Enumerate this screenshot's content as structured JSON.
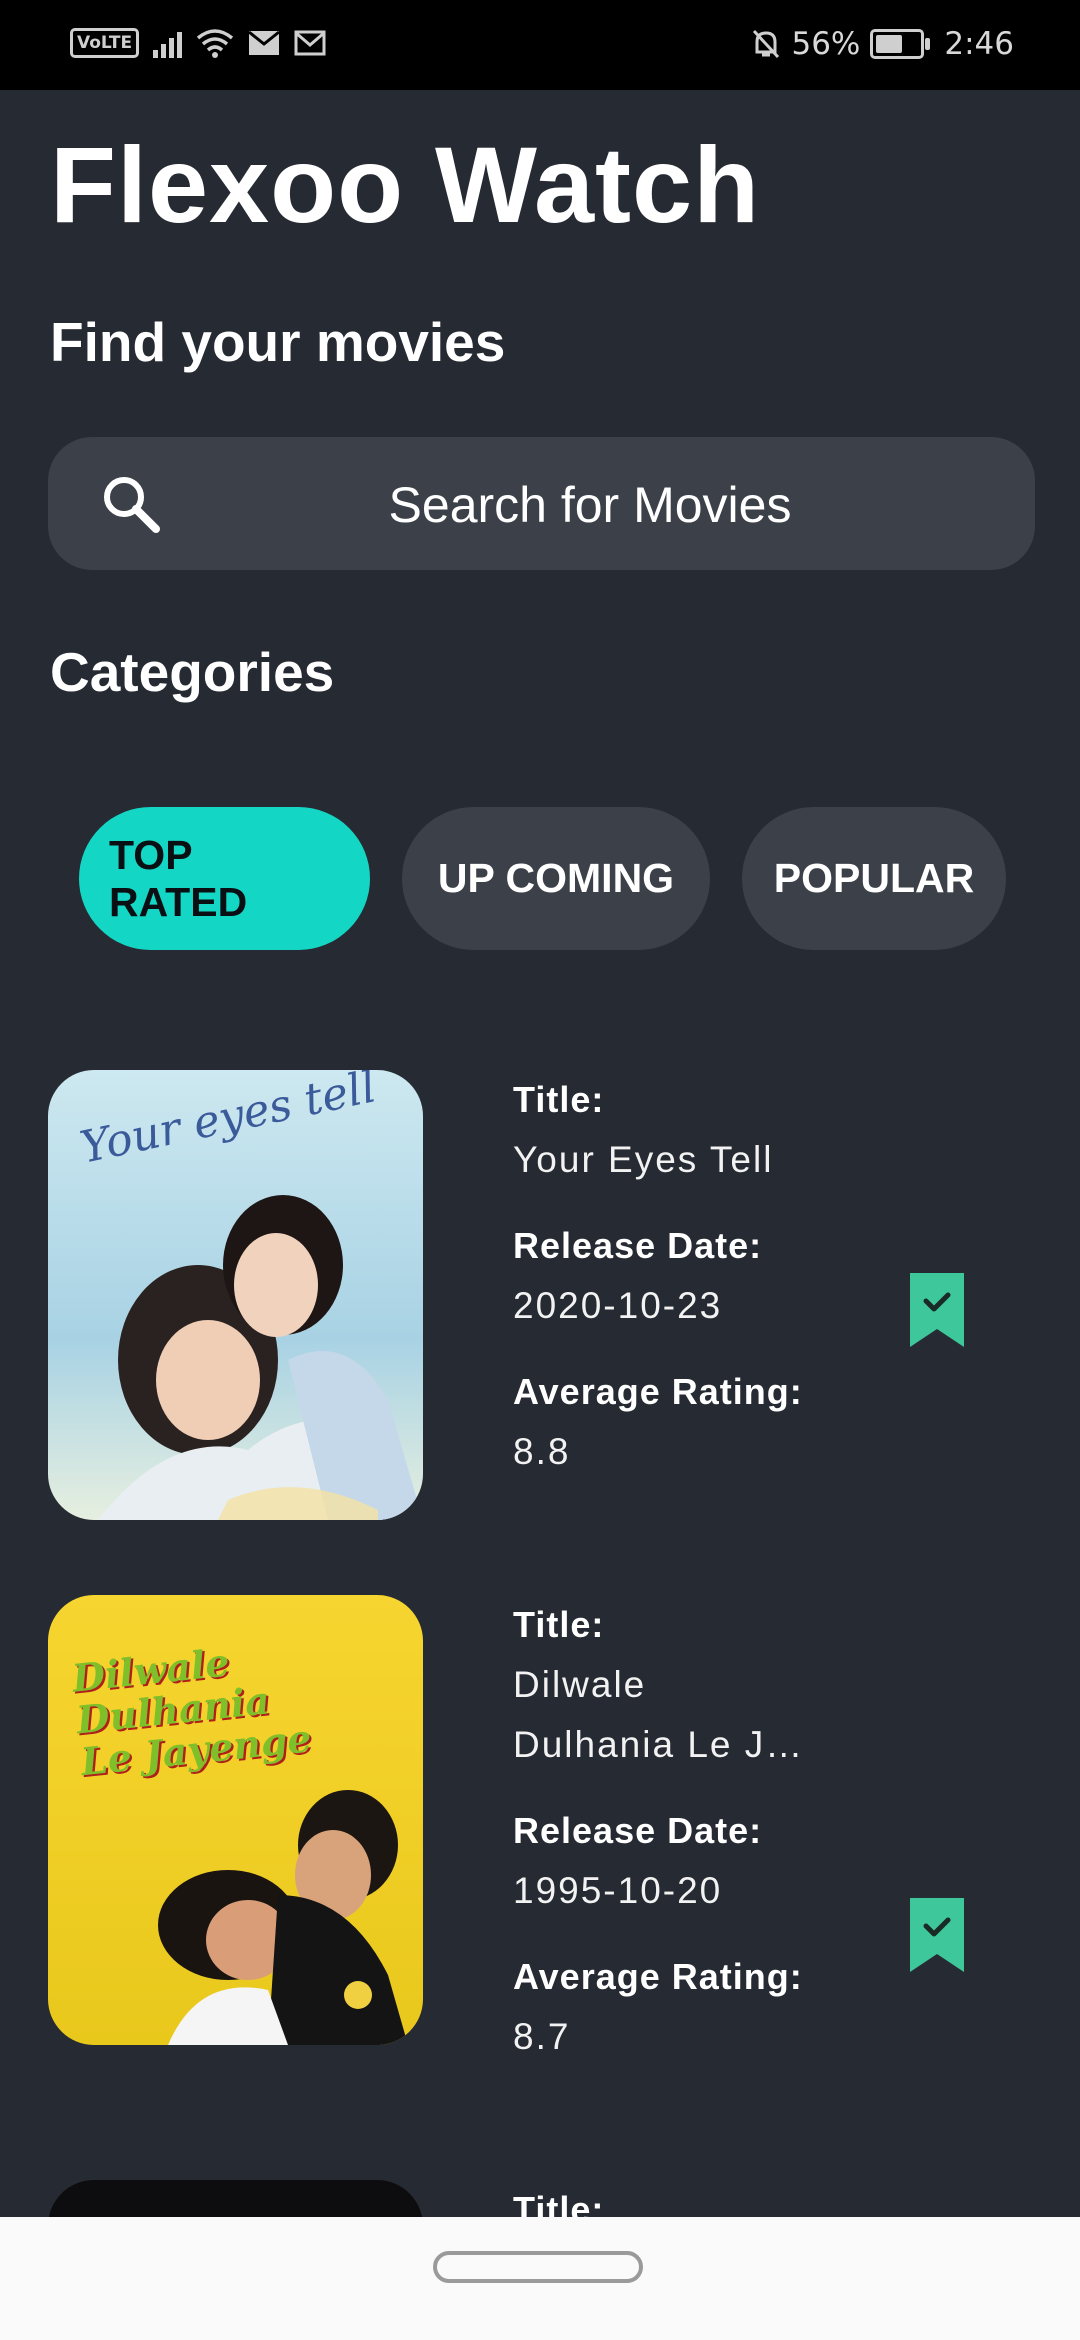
{
  "status_bar": {
    "volte": "VoLTE",
    "battery_text": "56%",
    "time": "2:46",
    "icons": [
      "volte-icon",
      "signal-icon",
      "wifi-icon",
      "mail-icon",
      "gmail-icon",
      "mute-icon",
      "battery-icon"
    ]
  },
  "app": {
    "title": "Flexoo Watch",
    "subtitle": "Find your movies"
  },
  "search": {
    "placeholder": "Search for Movies",
    "value": ""
  },
  "categories": {
    "heading": "Categories",
    "items": [
      {
        "label": "TOP RATED",
        "active": true
      },
      {
        "label": "UP COMING",
        "active": false
      },
      {
        "label": "POPULAR",
        "active": false
      }
    ]
  },
  "movies": [
    {
      "title_label": "Title:",
      "title": "Your Eyes Tell",
      "release_label": "Release Date:",
      "release_date": "2020-10-23",
      "rating_label": "Average Rating:",
      "rating": "8.8",
      "poster_text": "Your eyes tell",
      "bookmarked": true
    },
    {
      "title_label": "Title:",
      "title": "Dilwale Dulhania Le J…",
      "release_label": "Release Date:",
      "release_date": "1995-10-20",
      "rating_label": "Average Rating:",
      "rating": "8.7",
      "poster_text": "Dilwale Dulhania Le Jayenge",
      "bookmarked": true
    },
    {
      "title_label": "Title:"
    }
  ],
  "colors": {
    "background": "#262a32",
    "accent": "#14d6c5",
    "bookmark": "#3ec79a",
    "chip_inactive": "#3c4048"
  }
}
